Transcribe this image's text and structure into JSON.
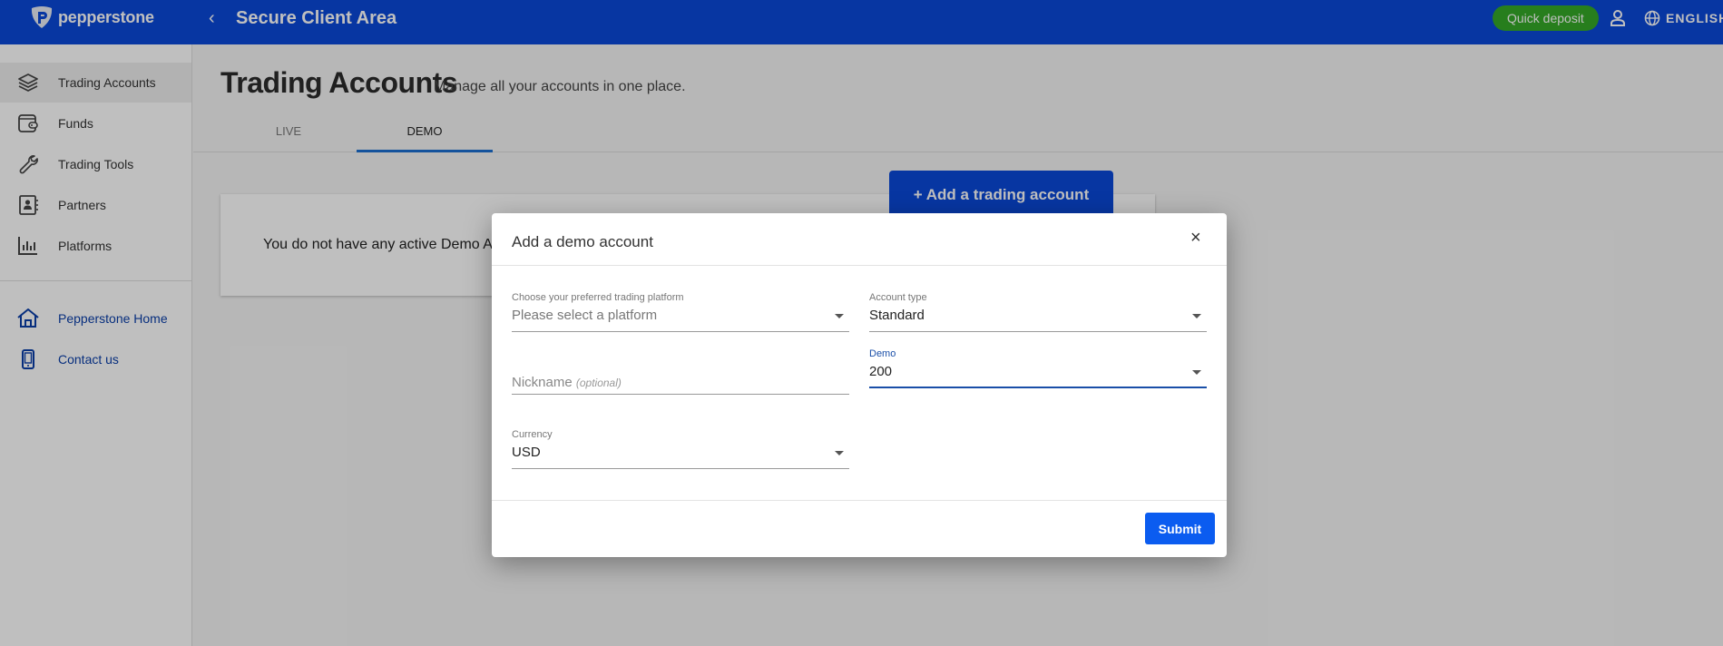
{
  "header": {
    "logo_text": "pepperstone",
    "app_title": "Secure Client Area",
    "quick_deposit_label": "Quick deposit",
    "language_label": "ENGLISH"
  },
  "sidebar": {
    "items": [
      {
        "label": "Trading Accounts",
        "icon": "layers-icon",
        "active": true
      },
      {
        "label": "Funds",
        "icon": "wallet-icon"
      },
      {
        "label": "Trading Tools",
        "icon": "wrench-icon"
      },
      {
        "label": "Partners",
        "icon": "contact-book-icon"
      },
      {
        "label": "Platforms",
        "icon": "bar-chart-icon"
      }
    ],
    "links": [
      {
        "label": "Pepperstone Home",
        "icon": "home-icon"
      },
      {
        "label": "Contact us",
        "icon": "mobile-phone-icon"
      }
    ]
  },
  "main": {
    "title": "Trading Accounts",
    "subtitle": "Manage all your accounts in one place.",
    "tabs": [
      {
        "label": "LIVE",
        "active": false
      },
      {
        "label": "DEMO",
        "active": true
      }
    ],
    "add_account_label": "+  Add a trading account",
    "empty_message": "You do not have any active Demo Accounts"
  },
  "modal": {
    "title": "Add a demo account",
    "close_glyph": "×",
    "fields": {
      "platform": {
        "label": "Choose your preferred trading platform",
        "value": "Please select a platform"
      },
      "account_type": {
        "label": "Account type",
        "value": "Standard"
      },
      "nickname": {
        "placeholder": "Nickname",
        "placeholder_hint": "(optional)"
      },
      "demo": {
        "label": "Demo",
        "value": "200"
      },
      "currency": {
        "label": "Currency",
        "value": "USD"
      }
    },
    "submit_label": "Submit"
  },
  "colors": {
    "brand_blue": "#0a49d8",
    "quick_deposit_green": "#34a827",
    "submit_blue": "#0b5cf0",
    "tab_indicator": "#1c6fd1"
  }
}
